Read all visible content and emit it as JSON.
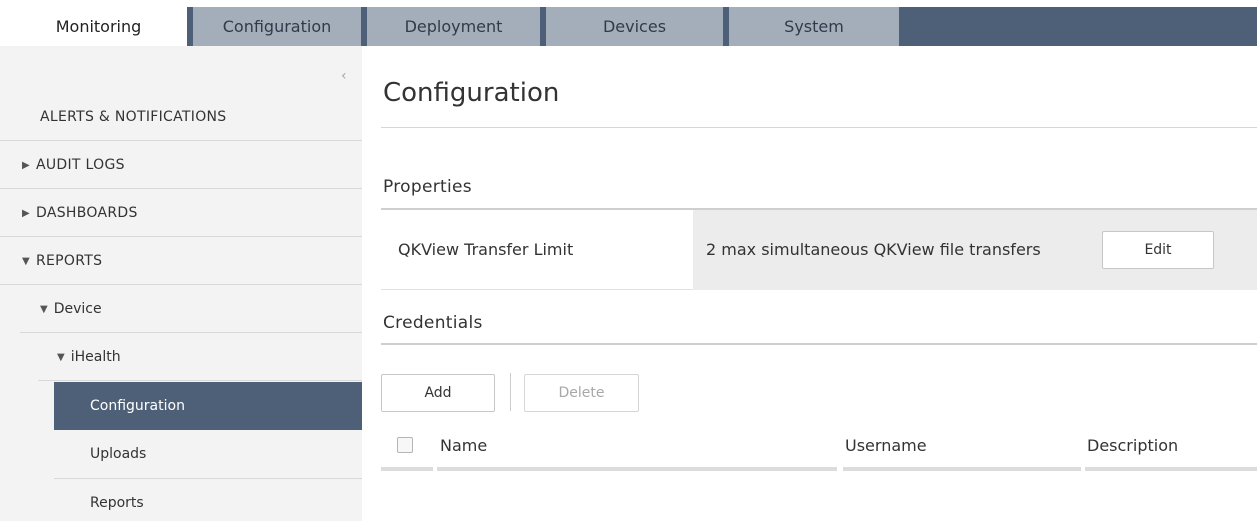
{
  "tabs": [
    {
      "label": "Monitoring",
      "active": true
    },
    {
      "label": "Configuration",
      "active": false
    },
    {
      "label": "Deployment",
      "active": false
    },
    {
      "label": "Devices",
      "active": false
    },
    {
      "label": "System",
      "active": false
    }
  ],
  "sidebar": {
    "collapse_icon": "chevron-left-icon",
    "items": [
      {
        "label": "ALERTS & NOTIFICATIONS",
        "arrow": ""
      },
      {
        "label": "AUDIT LOGS",
        "arrow": "▶"
      },
      {
        "label": "DASHBOARDS",
        "arrow": "▶"
      },
      {
        "label": "REPORTS",
        "arrow": "▼"
      },
      {
        "label": "Device",
        "arrow": "▼"
      },
      {
        "label": "iHealth",
        "arrow": "▼"
      },
      {
        "label": "Configuration",
        "arrow": "",
        "selected": true
      },
      {
        "label": "Uploads",
        "arrow": ""
      },
      {
        "label": "Reports",
        "arrow": ""
      }
    ]
  },
  "main": {
    "title": "Configuration",
    "properties": {
      "title": "Properties",
      "rows": [
        {
          "label": "QKView Transfer Limit",
          "value": "2 max simultaneous QKView file transfers",
          "button": "Edit"
        }
      ]
    },
    "credentials": {
      "title": "Credentials",
      "add_label": "Add",
      "delete_label": "Delete",
      "columns": [
        "Name",
        "Username",
        "Description"
      ]
    }
  },
  "colors": {
    "nav_dark": "#4d6078",
    "tab_inactive": "#a4aeba",
    "sidebar_bg": "#f3f3f3",
    "value_cell_bg": "#ececec"
  }
}
